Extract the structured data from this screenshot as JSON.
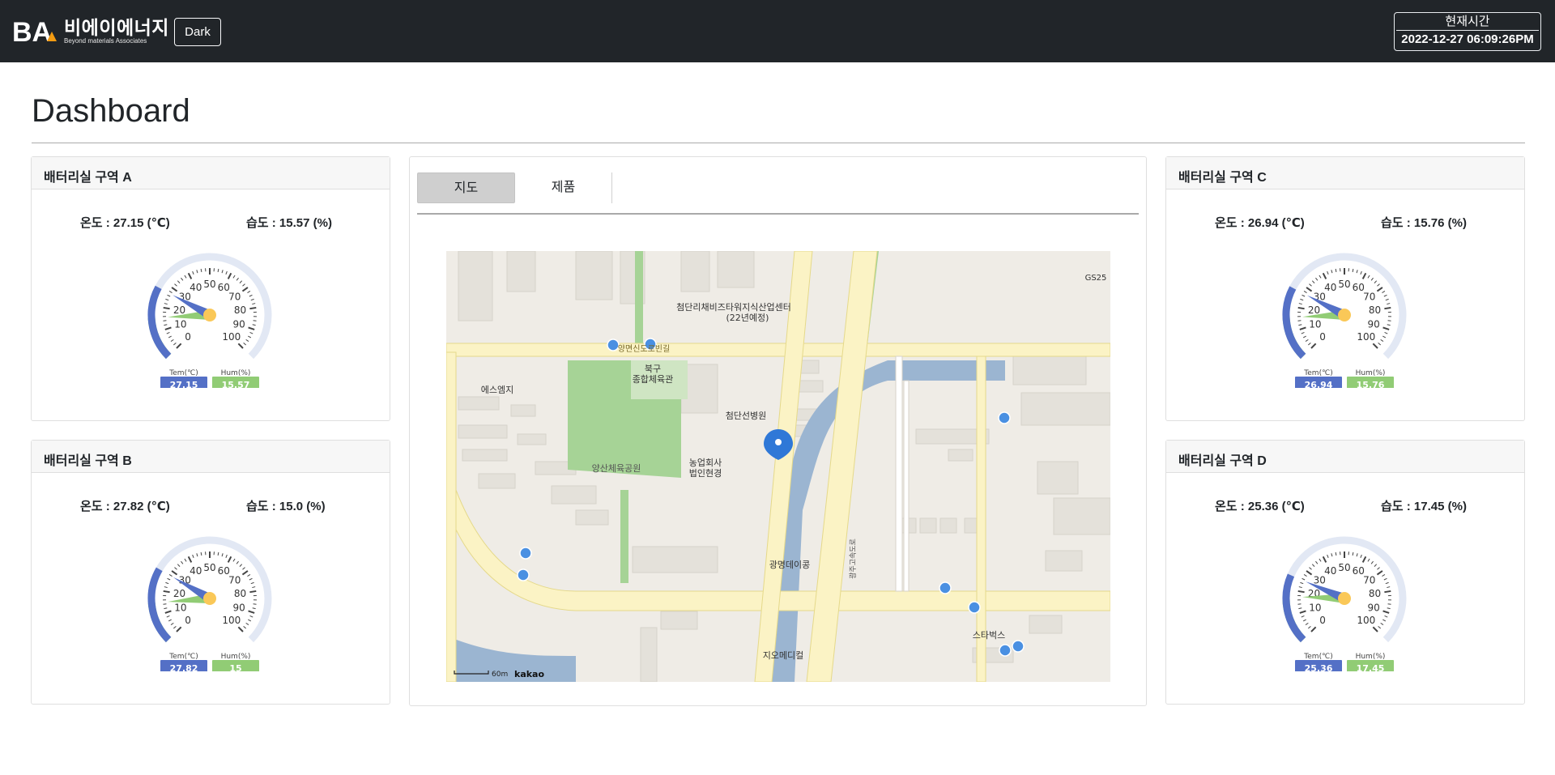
{
  "header": {
    "logo_mark": "BA",
    "logo_name": "비에이에너지",
    "logo_tagline": "Beyond materials Associates",
    "theme_button": "Dark",
    "clock_label": "현재시간",
    "clock_time": "2022-12-27 06:09:26PM"
  },
  "page": {
    "title": "Dashboard"
  },
  "gauge_labels": {
    "temp_unit": "Tem(℃)",
    "hum_unit": "Hum(%)",
    "scale": [
      "0",
      "10",
      "20",
      "30",
      "40",
      "50",
      "60",
      "70",
      "80",
      "90",
      "100"
    ]
  },
  "colors": {
    "temp": "#5470c6",
    "hum": "#91cc75",
    "marker": "#fac858"
  },
  "zones": [
    {
      "title": "배터리실 구역 A",
      "temp_text": "온도 : 27.15 (℃)",
      "hum_text": "습도 : 15.57 (%)",
      "temp": 27.15,
      "hum": 15.57,
      "temp_badge": "27.15",
      "hum_badge": "15.57"
    },
    {
      "title": "배터리실 구역 B",
      "temp_text": "온도 : 27.82 (℃)",
      "hum_text": "습도 : 15.0 (%)",
      "temp": 27.82,
      "hum": 15.0,
      "temp_badge": "27.82",
      "hum_badge": "15"
    },
    {
      "title": "배터리실 구역 C",
      "temp_text": "온도 : 26.94 (℃)",
      "hum_text": "습도 : 15.76 (%)",
      "temp": 26.94,
      "hum": 15.76,
      "temp_badge": "26.94",
      "hum_badge": "15.76"
    },
    {
      "title": "배터리실 구역 D",
      "temp_text": "온도 : 25.36 (℃)",
      "hum_text": "습도 : 17.45 (%)",
      "temp": 25.36,
      "hum": 17.45,
      "temp_badge": "25.36",
      "hum_badge": "17.45"
    }
  ],
  "tabs": {
    "map": "지도",
    "product": "제품"
  },
  "map": {
    "labels": {
      "center": "첨단리채비즈타워지식산업센터",
      "center2": "(22년예정)",
      "gym": "북구",
      "gym2": "종합체육관",
      "sm": "에스엠지",
      "hospital": "첨단선병원",
      "park": "양산체육공원",
      "coop": "농업회사",
      "coop2": "법인현경",
      "gwangmyeong": "광명데이콩",
      "starbucks": "스타벅스",
      "gio": "지오메디컬",
      "gs25": "GS25",
      "road": "양면신도로빈길",
      "expressway": "광주고속도로",
      "scale": "60m",
      "brand": "kakao"
    }
  }
}
